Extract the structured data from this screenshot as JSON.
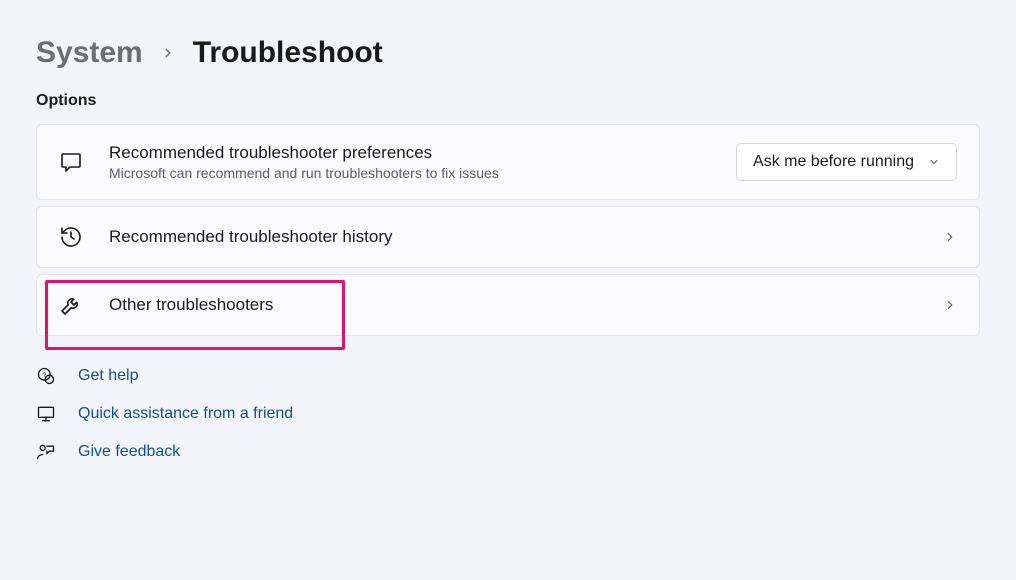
{
  "breadcrumb": {
    "parent": "System",
    "current": "Troubleshoot"
  },
  "section_title": "Options",
  "cards": {
    "prefs": {
      "title": "Recommended troubleshooter preferences",
      "subtitle": "Microsoft can recommend and run troubleshooters to fix issues",
      "dropdown_value": "Ask me before running"
    },
    "history": {
      "title": "Recommended troubleshooter history"
    },
    "other": {
      "title": "Other troubleshooters"
    }
  },
  "links": {
    "help": "Get help",
    "quick": "Quick assistance from a friend",
    "feedback": "Give feedback"
  }
}
